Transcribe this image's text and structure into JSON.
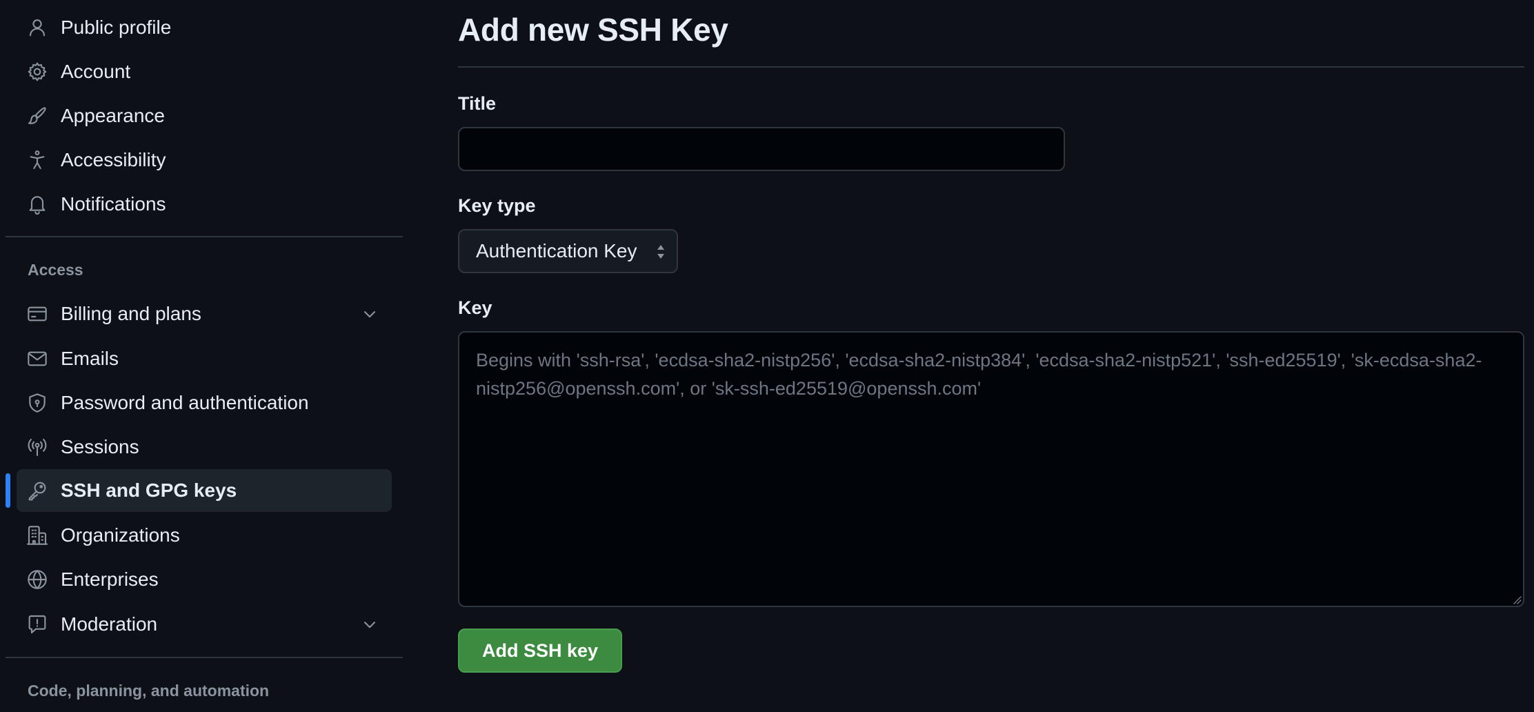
{
  "colors": {
    "background": "#0d1117",
    "text": "#e6edf3",
    "muted": "#8b949e",
    "border": "#30363d",
    "accent_blue": "#2f81f7",
    "button_green": "#3d8a41",
    "active_item_bg": "#1e242c"
  },
  "sidebar": {
    "items": [
      {
        "label": "Public profile",
        "icon": "person-icon"
      },
      {
        "label": "Account",
        "icon": "gear-icon"
      },
      {
        "label": "Appearance",
        "icon": "paintbrush-icon"
      },
      {
        "label": "Accessibility",
        "icon": "accessibility-icon"
      },
      {
        "label": "Notifications",
        "icon": "bell-icon"
      }
    ],
    "access_heading": "Access",
    "access_items": [
      {
        "label": "Billing and plans",
        "icon": "credit-card-icon",
        "expandable": true
      },
      {
        "label": "Emails",
        "icon": "mail-icon"
      },
      {
        "label": "Password and authentication",
        "icon": "shield-lock-icon"
      },
      {
        "label": "Sessions",
        "icon": "broadcast-icon"
      },
      {
        "label": "SSH and GPG keys",
        "icon": "key-icon",
        "active": true
      },
      {
        "label": "Organizations",
        "icon": "organization-icon"
      },
      {
        "label": "Enterprises",
        "icon": "globe-icon"
      },
      {
        "label": "Moderation",
        "icon": "report-icon",
        "expandable": true
      }
    ],
    "code_heading": "Code, planning, and automation"
  },
  "main": {
    "title": "Add new SSH Key",
    "title_field": {
      "label": "Title",
      "value": "",
      "placeholder": ""
    },
    "key_type": {
      "label": "Key type",
      "selected": "Authentication Key"
    },
    "key_field": {
      "label": "Key",
      "value": "",
      "placeholder": "Begins with 'ssh-rsa', 'ecdsa-sha2-nistp256', 'ecdsa-sha2-nistp384', 'ecdsa-sha2-nistp521', 'ssh-ed25519', 'sk-ecdsa-sha2-nistp256@openssh.com', or 'sk-ssh-ed25519@openssh.com'"
    },
    "submit_label": "Add SSH key"
  }
}
